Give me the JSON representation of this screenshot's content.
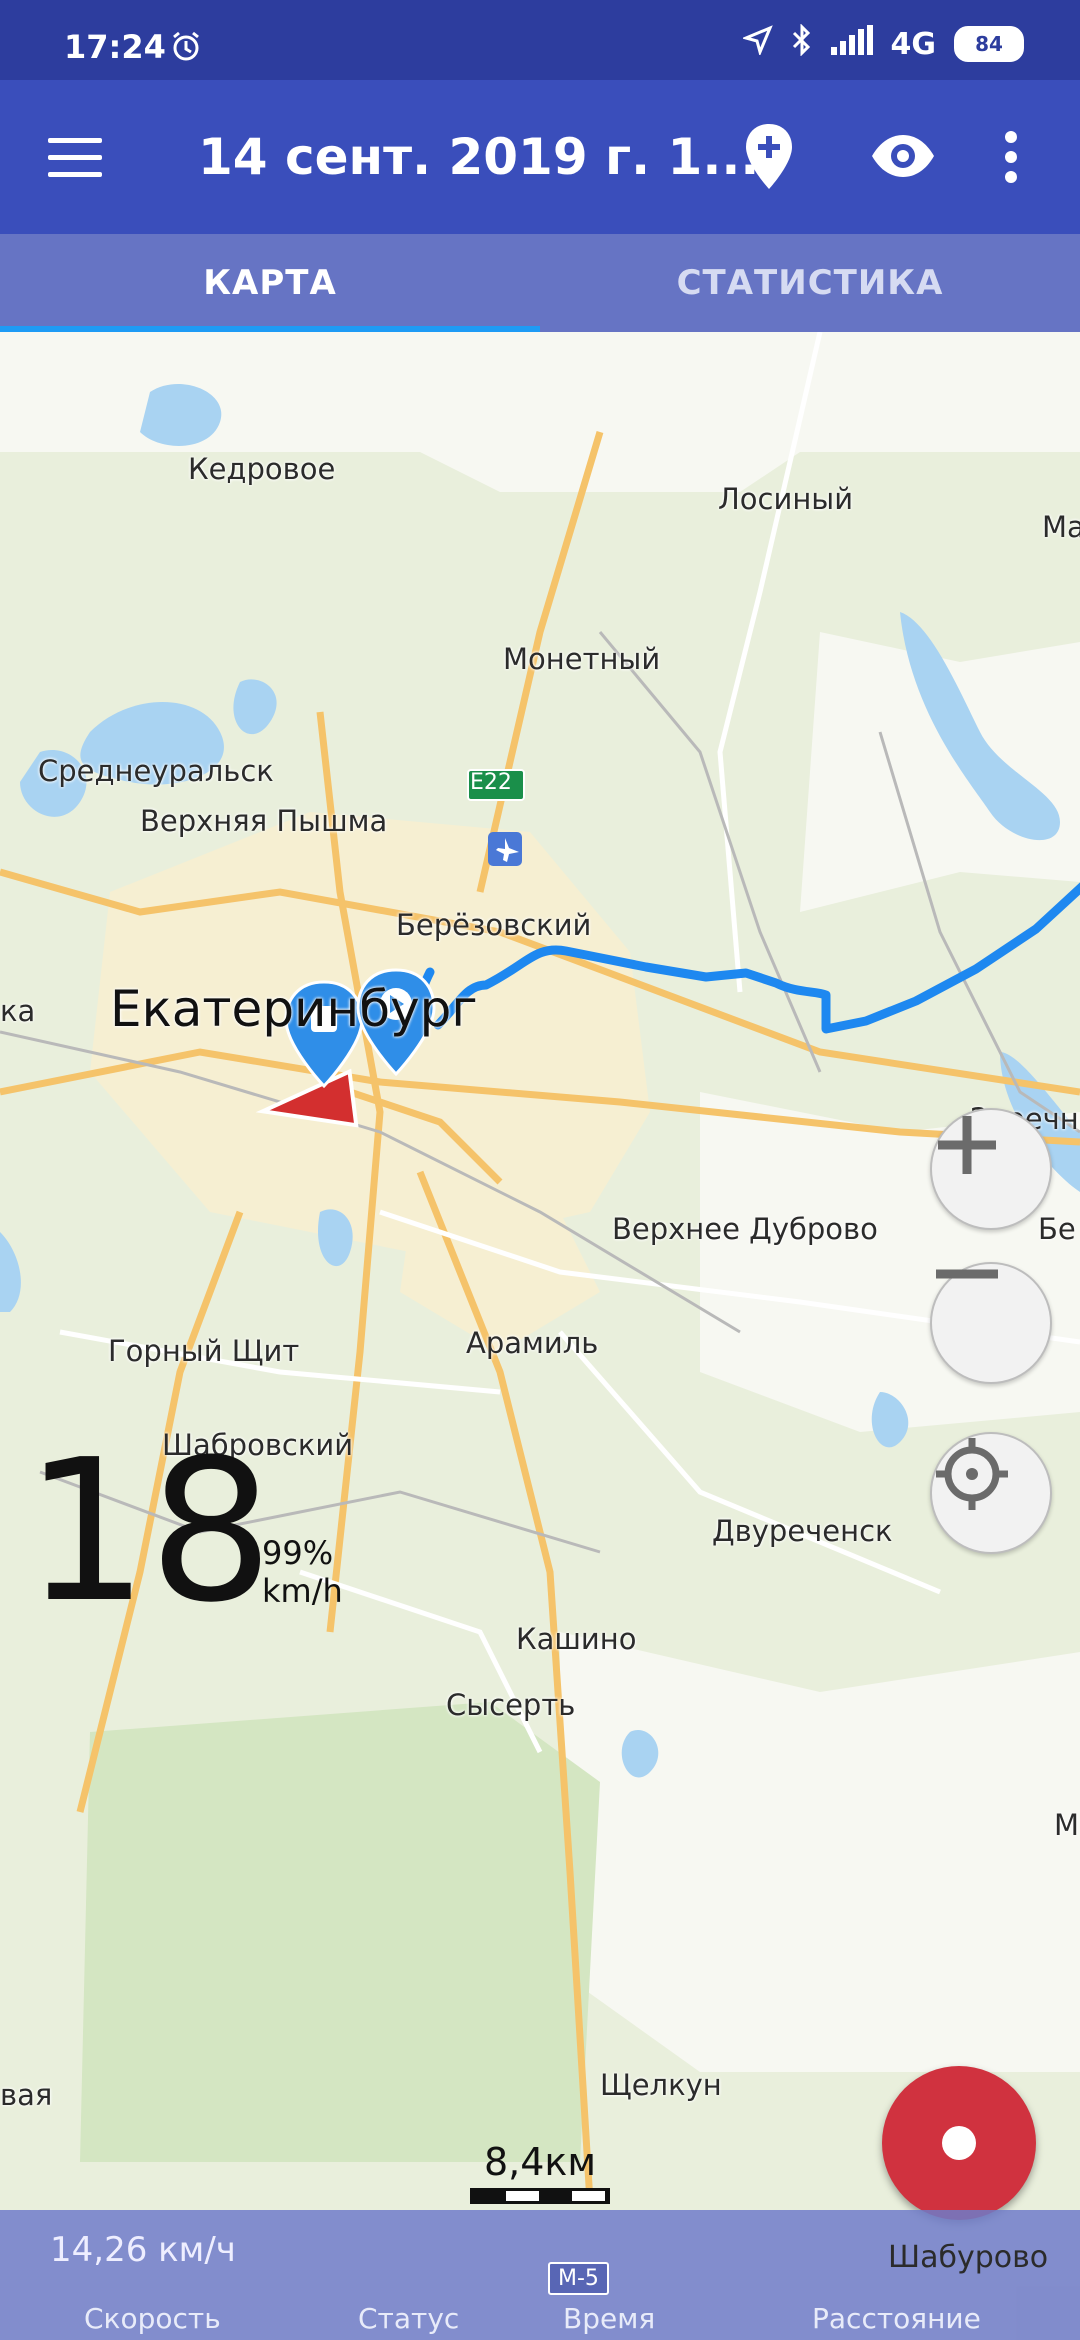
{
  "status_bar": {
    "time": "17:24",
    "network": "4G",
    "battery": "84"
  },
  "app_bar": {
    "title": "14 сент. 2019 г. 1..."
  },
  "tabs": [
    {
      "label": "КАРТА"
    },
    {
      "label": "СТАТИСТИКА"
    }
  ],
  "map": {
    "places": [
      "Кедровое",
      "Лосиный",
      "Ма",
      "Монетный",
      "Среднеуральск",
      "Верхняя Пышма",
      "Берёзовский",
      "ка",
      "Екатеринбург",
      "Заречн",
      "Верхнее Дуброво",
      "Бе",
      "Горный Щит",
      "Арамиль",
      "Шабровский",
      "Двуреченск",
      "Кашино",
      "Сысерть",
      "М",
      "вая",
      "Щелкун",
      "Шабурово"
    ],
    "road_labels": [
      "E22",
      "M-5"
    ],
    "scale": "8,4км"
  },
  "speed_overlay": {
    "value": "18",
    "percent": "99%",
    "unit": "km/h"
  },
  "bottom_bar": {
    "speed_value": "14,26 км/ч",
    "labels": [
      "Скорость",
      "Статус",
      "Время",
      "Расстояние"
    ]
  },
  "colors": {
    "primary": "#3a4ebb",
    "status_bar": "#2d3d9e",
    "tabs": "#6674c4",
    "track": "#1e88f0",
    "record": "#d0323f"
  },
  "icons": [
    "alarm-icon",
    "location-arrow-icon",
    "bluetooth-icon",
    "signal-icon",
    "menu-icon",
    "add-pin-icon",
    "eye-icon",
    "more-vert-icon",
    "zoom-in-icon",
    "zoom-out-icon",
    "locate-icon",
    "record-icon",
    "start-marker-icon",
    "stop-marker-icon",
    "direction-arrow-icon",
    "airport-icon"
  ]
}
